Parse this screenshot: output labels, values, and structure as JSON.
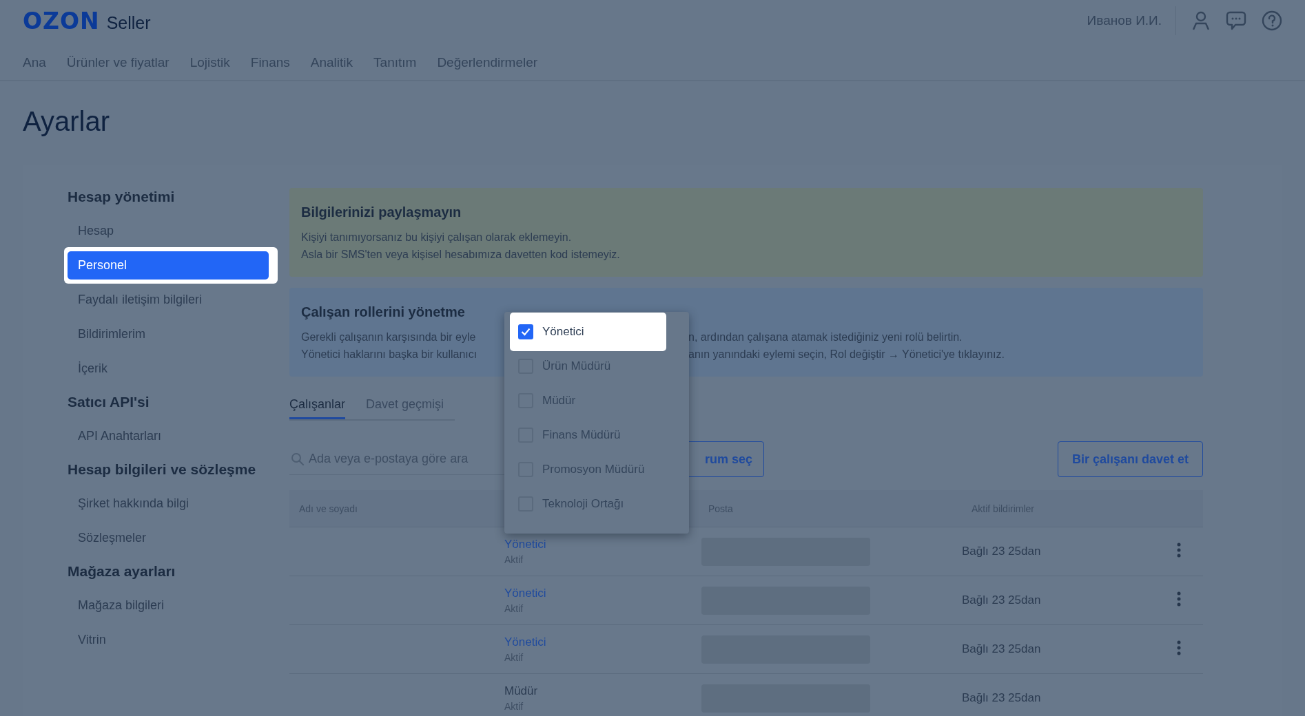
{
  "header": {
    "logo": "OZON",
    "logo_suffix": "Seller",
    "user": "Иванов И.И.",
    "nav": [
      "Ana",
      "Ürünler ve fiyatlar",
      "Lojistik",
      "Finans",
      "Analitik",
      "Tanıtım",
      "Değerlendirmeler"
    ]
  },
  "page_title": "Ayarlar",
  "sidebar": {
    "sections": [
      {
        "title": "Hesap yönetimi",
        "items": [
          {
            "label": "Hesap",
            "selected": false,
            "highlighted": false
          },
          {
            "label": "Personel",
            "selected": true,
            "highlighted": true
          },
          {
            "label": "Faydalı iletişim bilgileri",
            "selected": false,
            "highlighted": false
          },
          {
            "label": "Bildirimlerim",
            "selected": false,
            "highlighted": false
          },
          {
            "label": "İçerik",
            "selected": false,
            "highlighted": false
          }
        ]
      },
      {
        "title": "Satıcı API'si",
        "items": [
          {
            "label": "API Anahtarları",
            "selected": false,
            "highlighted": false
          }
        ]
      },
      {
        "title": "Hesap bilgileri ve sözleşme",
        "items": [
          {
            "label": "Şirket hakkında bilgi",
            "selected": false,
            "highlighted": false
          },
          {
            "label": "Sözleşmeler",
            "selected": false,
            "highlighted": false
          }
        ]
      },
      {
        "title": "Mağaza ayarları",
        "items": [
          {
            "label": "Mağaza bilgileri",
            "selected": false,
            "highlighted": false
          },
          {
            "label": "Vitrin",
            "selected": false,
            "highlighted": false
          }
        ]
      }
    ]
  },
  "notices": [
    {
      "kind": "warning",
      "title": "Bilgilerinizi paylaşmayın",
      "lines": [
        [
          "Kişiyi tanımıyorsanız bu kişiyi çalışan olarak eklemeyin."
        ],
        [
          "Asla bir SMS'ten veya kişisel hesabımıza davetten kod istemeyiz."
        ]
      ]
    },
    {
      "kind": "info",
      "title": "Çalışan rollerini yönetme",
      "lines": [
        [
          "Gerekli çalışanın karşısında bir eyle",
          "n, ardından çalışana atamak istediğiniz yeni rolü belirtin."
        ],
        [
          "Yönetici haklarını başka bir kullanıcı",
          "anın yanındaki eylemi seçin, Rol değiştir → Yönetici'ye tıklayınız."
        ]
      ]
    }
  ],
  "tabs": [
    {
      "label": "Çalışanlar",
      "selected": true
    },
    {
      "label": "Davet geçmişi",
      "selected": false
    }
  ],
  "search": {
    "placeholder": "Ada veya e-postaya göre ara"
  },
  "filter_button": "rum seç",
  "invite_button": "Bir çalışanı davet et",
  "table": {
    "columns": [
      "Adı ve soyadı",
      "Posta",
      "Aktif bildirimler"
    ],
    "rows": [
      {
        "kind": "link",
        "role": "Yönetici",
        "status": "Aktif",
        "notifications": "Bağlı 23 25dan",
        "menu": true
      },
      {
        "kind": "link",
        "role": "Yönetici",
        "status": "Aktif",
        "notifications": "Bağlı 23 25dan",
        "menu": true
      },
      {
        "kind": "link",
        "role": "Yönetici",
        "status": "Aktif",
        "notifications": "Bağlı 23 25dan",
        "menu": true
      },
      {
        "kind": "plain",
        "role": "Müdür",
        "status": "Aktif",
        "notifications": "Bağlı 23 25dan",
        "menu": false
      }
    ]
  },
  "role_dropdown": {
    "options": [
      {
        "label": "Yönetici",
        "checked": true,
        "highlighted": true
      },
      {
        "label": "Ürün Müdürü",
        "checked": false,
        "highlighted": false
      },
      {
        "label": "Müdür",
        "checked": false,
        "highlighted": false
      },
      {
        "label": "Finans Müdürü",
        "checked": false,
        "highlighted": false
      },
      {
        "label": "Promosyon Müdürü",
        "checked": false,
        "highlighted": false
      },
      {
        "label": "Teknoloji Ortağı",
        "checked": false,
        "highlighted": false
      }
    ]
  }
}
